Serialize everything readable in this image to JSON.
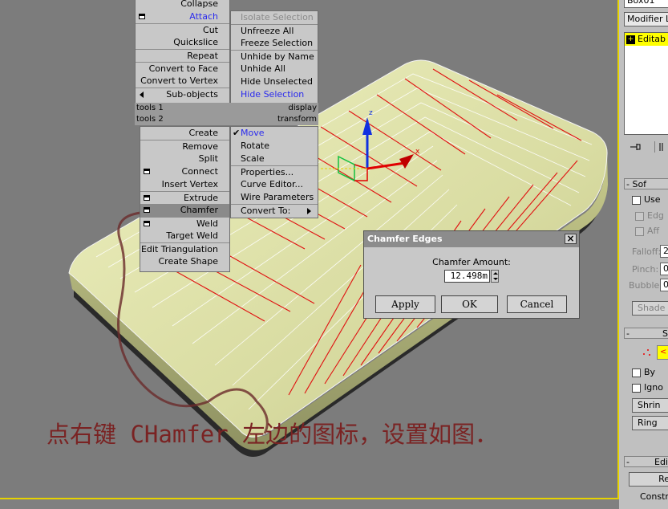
{
  "viewport": {
    "caption": "点右键 CHamfer 左边的图标，设置如图．",
    "axis": {
      "z": "z",
      "x": "x"
    }
  },
  "quad_left": {
    "items": [
      {
        "label": "Collapse"
      },
      {
        "label": "Attach"
      },
      {
        "label": "Cut"
      },
      {
        "label": "Quickslice"
      },
      {
        "label": "Repeat"
      },
      {
        "label": "Convert to Face"
      },
      {
        "label": "Convert to Vertex"
      },
      {
        "label": "Sub-objects"
      }
    ],
    "header1_left": "tools 1",
    "header1_right": "display",
    "header2_left": "tools 2",
    "header2_right": "transform"
  },
  "quad_right_top": {
    "items": [
      {
        "label": "Isolate Selection"
      },
      {
        "label": "Unfreeze All"
      },
      {
        "label": "Freeze Selection"
      },
      {
        "label": "Unhide by Name"
      },
      {
        "label": "Unhide All"
      },
      {
        "label": "Hide Unselected"
      },
      {
        "label": "Hide Selection"
      }
    ]
  },
  "quad_left_bottom": {
    "items": [
      {
        "label": "Create"
      },
      {
        "label": "Remove"
      },
      {
        "label": "Split"
      },
      {
        "label": "Connect"
      },
      {
        "label": "Insert Vertex"
      },
      {
        "label": "Extrude"
      },
      {
        "label": "Chamfer"
      },
      {
        "label": "Weld"
      },
      {
        "label": "Target Weld"
      },
      {
        "label": "Edit Triangulation"
      },
      {
        "label": "Create Shape"
      }
    ]
  },
  "quad_right_bottom": {
    "items": [
      {
        "label": "Move"
      },
      {
        "label": "Rotate"
      },
      {
        "label": "Scale"
      },
      {
        "label": "Properties..."
      },
      {
        "label": "Curve Editor..."
      },
      {
        "label": "Wire Parameters"
      },
      {
        "label": "Convert To:"
      }
    ]
  },
  "dialog": {
    "title": "Chamfer Edges",
    "amount_label": "Chamfer Amount:",
    "amount_value": "12.498m",
    "apply": "Apply",
    "ok": "OK",
    "cancel": "Cancel",
    "close": "×"
  },
  "side": {
    "object_name": "Box01",
    "modifier_list": "Modifier Lis",
    "stack_item": "Editab",
    "rollout_soft": "Sof",
    "use": "Use",
    "edge": "Edg",
    "affect": "Aff",
    "falloff": "Falloff:",
    "falloff_val": "2",
    "pinch": "Pinch:",
    "pinch_val": "0",
    "bubble": "Bubble:",
    "bubble_val": "0",
    "shaded": "Shade",
    "rollout_sel": "S",
    "by": "By",
    "ignore": "Igno",
    "shrink": "Shrin",
    "ring": "Ring",
    "rollout_edit": "Edi",
    "re": "Re",
    "constrain": "Constra"
  },
  "colors": {
    "viewport_bg": "#7c7c7c",
    "mesh": "#dde0a8",
    "edge_sel": "#e01010",
    "menu_bg": "#c8c8c8",
    "caption": "#7a2323",
    "stack_bg": "#ffff00"
  }
}
